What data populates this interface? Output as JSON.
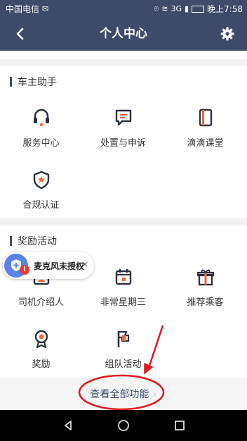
{
  "status_bar": {
    "carrier": "中国电信",
    "time": "晚上7:58",
    "network": "3G",
    "battery_icon": "battery-icon"
  },
  "header": {
    "title": "个人中心",
    "back_icon": "back-arrow-icon",
    "settings_icon": "gear-icon"
  },
  "sections": [
    {
      "title": "车主助手",
      "items": [
        {
          "label": "服务中心",
          "icon": "headset-icon"
        },
        {
          "label": "处置与申诉",
          "icon": "message-icon"
        },
        {
          "label": "滴滴课堂",
          "icon": "phone-book-icon"
        },
        {
          "label": "合规认证",
          "icon": "shield-star-icon"
        }
      ]
    },
    {
      "title": "奖励活动",
      "items": [
        {
          "label": "司机介绍人",
          "icon": "user-card-icon"
        },
        {
          "label": "非常星期三",
          "icon": "calendar-icon"
        },
        {
          "label": "推荐乘客",
          "icon": "gift-icon"
        },
        {
          "label": "奖励",
          "icon": "medal-icon"
        },
        {
          "label": "组队活动",
          "icon": "flag-icon"
        }
      ]
    }
  ],
  "view_all": "查看全部功能",
  "mic_banner": {
    "text": "麦克风未授权",
    "badge": "!",
    "close": "×"
  },
  "colors": {
    "header": "#3d4b68",
    "accent": "#f06a35",
    "annotation": "#e0191f"
  }
}
